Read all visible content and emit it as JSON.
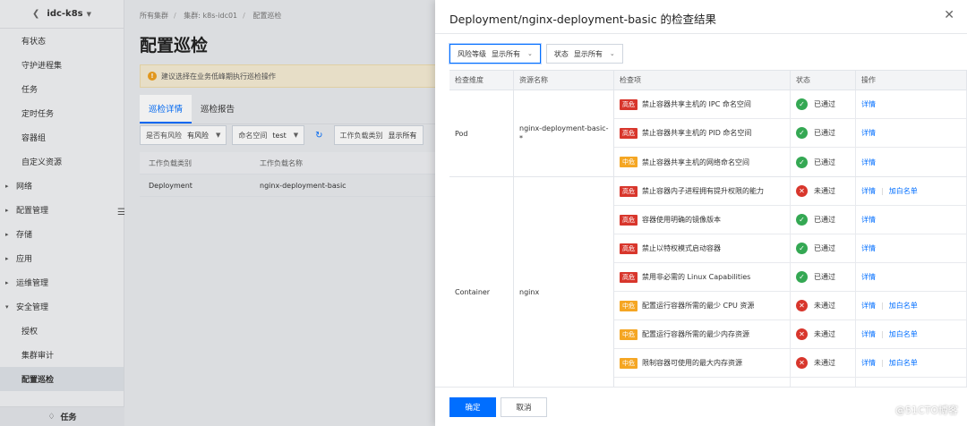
{
  "colors": {
    "primary": "#006eff",
    "high": "#d8362c",
    "mid": "#f5a623",
    "low": "#6b7c93",
    "pass": "#34a853",
    "fail": "#d8362c"
  },
  "sidebar": {
    "cluster": "idc-k8s",
    "items": [
      {
        "label": "有状态",
        "kind": "child"
      },
      {
        "label": "守护进程集",
        "kind": "child"
      },
      {
        "label": "任务",
        "kind": "child"
      },
      {
        "label": "定时任务",
        "kind": "child"
      },
      {
        "label": "容器组",
        "kind": "child"
      },
      {
        "label": "自定义资源",
        "kind": "child"
      },
      {
        "label": "网络",
        "kind": "group",
        "icon": "chevron-right-icon"
      },
      {
        "label": "配置管理",
        "kind": "group",
        "icon": "chevron-right-icon"
      },
      {
        "label": "存储",
        "kind": "group",
        "icon": "chevron-right-icon"
      },
      {
        "label": "应用",
        "kind": "group",
        "icon": "chevron-right-icon"
      },
      {
        "label": "运维管理",
        "kind": "group",
        "icon": "chevron-right-icon"
      },
      {
        "label": "安全管理",
        "kind": "group",
        "icon": "chevron-down-icon"
      },
      {
        "label": "授权",
        "kind": "child"
      },
      {
        "label": "集群审计",
        "kind": "child"
      },
      {
        "label": "配置巡检",
        "kind": "child",
        "active": true
      }
    ],
    "footer_label": "任务"
  },
  "main": {
    "breadcrumb": [
      "所有集群",
      "集群: k8s-idc01",
      "配置巡检"
    ],
    "title": "配置巡检",
    "notice": "建议选择在业务低峰期执行巡检操作",
    "tabs": [
      "巡检详情",
      "巡检报告"
    ],
    "filters": [
      {
        "key": "是否有风险",
        "value": "有风险"
      },
      {
        "key": "命名空间",
        "value": "test"
      },
      {
        "key": "工作负载类别",
        "value": "显示所有"
      }
    ],
    "table": {
      "headers": [
        "工作负载类别",
        "工作负载名称"
      ],
      "rows": [
        [
          "Deployment",
          "nginx-deployment-basic"
        ]
      ]
    }
  },
  "drawer": {
    "title": "Deployment/nginx-deployment-basic 的检查结果",
    "filters": [
      {
        "key": "风险等级",
        "value": "显示所有"
      },
      {
        "key": "状态",
        "value": "显示所有"
      }
    ],
    "headers": [
      "检查维度",
      "资源名称",
      "检查项",
      "状态",
      "操作"
    ],
    "groups": [
      {
        "dimension": "Pod",
        "resource": "nginx-deployment-basic-*",
        "rows": [
          {
            "level": "高危",
            "item": "禁止容器共享主机的 IPC 命名空间",
            "status": "已通过",
            "ops": [
              "详情"
            ]
          },
          {
            "level": "高危",
            "item": "禁止容器共享主机的 PID 命名空间",
            "status": "已通过",
            "ops": [
              "详情"
            ]
          },
          {
            "level": "中危",
            "item": "禁止容器共享主机的网络命名空间",
            "status": "已通过",
            "ops": [
              "详情"
            ]
          }
        ]
      },
      {
        "dimension": "Container",
        "resource": "nginx",
        "rows": [
          {
            "level": "高危",
            "item": "禁止容器内子进程拥有提升权限的能力",
            "status": "未通过",
            "ops": [
              "详情",
              "加白名单"
            ]
          },
          {
            "level": "高危",
            "item": "容器使用明确的镜像版本",
            "status": "已通过",
            "ops": [
              "详情"
            ]
          },
          {
            "level": "高危",
            "item": "禁止以特权模式启动容器",
            "status": "已通过",
            "ops": [
              "详情"
            ]
          },
          {
            "level": "高危",
            "item": "禁用非必需的 Linux Capabilities",
            "status": "已通过",
            "ops": [
              "详情"
            ]
          },
          {
            "level": "中危",
            "item": "配置运行容器所需的最少 CPU 资源",
            "status": "未通过",
            "ops": [
              "详情",
              "加白名单"
            ]
          },
          {
            "level": "中危",
            "item": "配置运行容器所需的最少内存资源",
            "status": "未通过",
            "ops": [
              "详情",
              "加白名单"
            ]
          },
          {
            "level": "中危",
            "item": "限制容器可使用的最大内存资源",
            "status": "未通过",
            "ops": [
              "详情",
              "加白名单"
            ]
          },
          {
            "level": "中危",
            "item": "",
            "status": "",
            "ops": []
          }
        ]
      }
    ],
    "ok_label": "确定",
    "cancel_label": "取消"
  },
  "watermark": "@51CTO博客"
}
